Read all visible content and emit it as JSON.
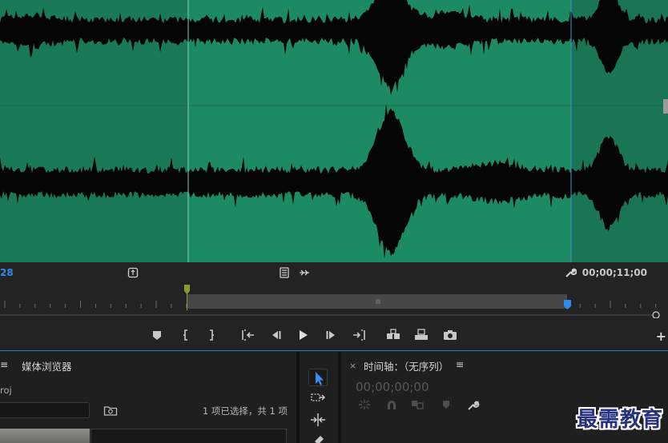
{
  "monitor": {
    "timecode_left": "28",
    "timecode_right": "00;00;11;00"
  },
  "colors": {
    "waveform_bg": "#1c8a62",
    "waveform_out_of_range": "#197554",
    "accent_blue": "#2d8ceb",
    "in_marker": "#8a9a2c"
  },
  "transport": {
    "buttons": [
      "add-marker",
      "mark-in",
      "mark-out",
      "go-to-in",
      "step-back",
      "play",
      "step-forward",
      "go-to-out",
      "insert",
      "overwrite",
      "export-frame",
      "add-button"
    ]
  },
  "project_panel": {
    "menu_glyph": "≡",
    "tab_label": "媒体浏览器",
    "file_label": "roj",
    "selection_status": "1 项已选择，共 1 项"
  },
  "tools": [
    "selection-tool",
    "track-select-tool",
    "ripple-edit-tool",
    "razor-tool"
  ],
  "timeline_panel": {
    "close_glyph": "×",
    "title": "时间轴：（无序列）",
    "menu_glyph": "≡",
    "timecode": "00;00;00;00"
  },
  "watermark": "最需教育"
}
